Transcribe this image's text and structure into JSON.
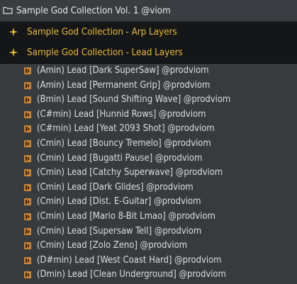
{
  "root": {
    "label": "Sample God Collection Vol. 1 @viom"
  },
  "categories": [
    {
      "label": "Sample God Collection - Arp Layers"
    },
    {
      "label": "Sample God Collection - Lead Layers"
    }
  ],
  "items": [
    "(Amin) Lead [Dark SuperSaw] @prodviom",
    "(Amin) Lead [Permanent Grip] @prodviom",
    "(Bmin) Lead [Sound Shifting Wave] @prodviom",
    "(C#min) Lead [Hunnid Rows] @prodviom",
    "(C#min) Lead [Yeat 2093 Shot] @prodviom",
    "(Cmin) Lead [Bouncy Tremelo] @prodviom",
    "(Cmin) Lead [Bugatti Pause] @prodviom",
    "(Cmin) Lead [Catchy Superwave] @prodviom",
    "(Cmin) Lead [Dark Glides] @prodviom",
    "(Cmin) Lead [Dist. E-Guitar] @prodviom",
    "(Cmin) Lead [Mario 8-Bit Lmao] @prodviom",
    "(Cmin) Lead [Supersaw Tell] @prodviom",
    "(Cmin) Lead [Zolo Zeno] @prodviom",
    "(D#min) Lead [West Coast Hard] @prodviom",
    "(Dmin) Lead [Clean Underground] @prodviom"
  ],
  "colors": {
    "background": "#383b3e",
    "category_background": "#141618",
    "category_text": "#e6b93a",
    "item_text": "#dcdcdc",
    "file_icon": "#c9853a"
  },
  "icons": {
    "root": "folder-icon",
    "category": "sparkle-icon",
    "item": "audio-file-icon"
  }
}
